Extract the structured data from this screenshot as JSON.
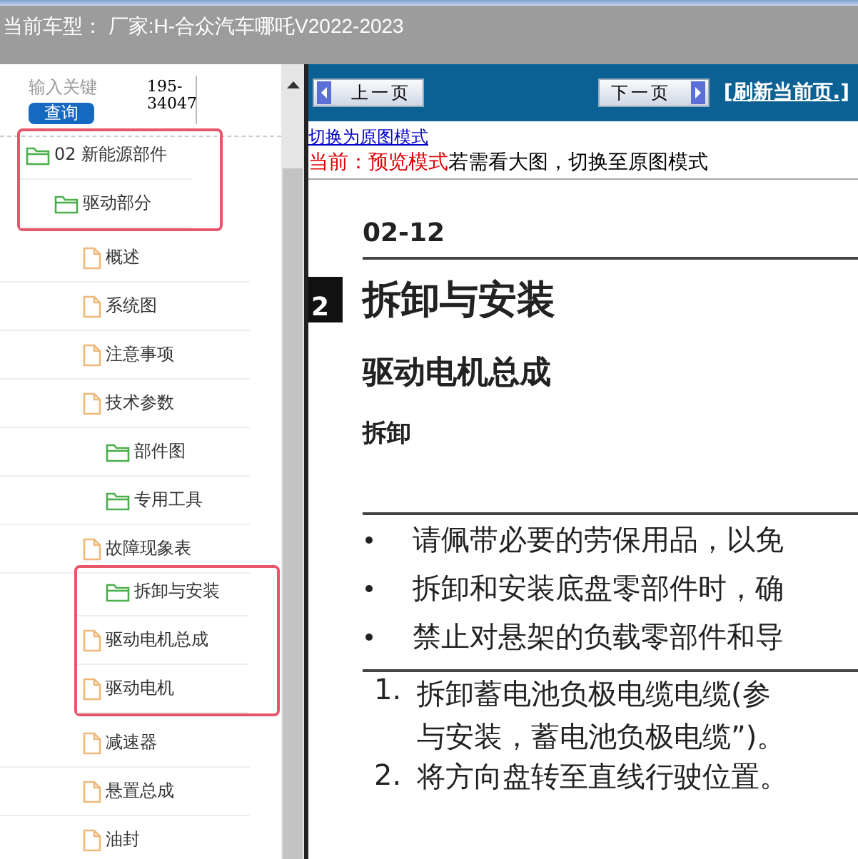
{
  "header": {
    "title": "当前车型：  厂家:H-合众汽车哪吒V2022-2023"
  },
  "search": {
    "placeholder": "输入关键",
    "button": "查询",
    "code": "195-34047"
  },
  "tree": [
    {
      "label": "02 新能源部件",
      "kind": "folder",
      "highlighted": true,
      "children": [
        {
          "label": "驱动部分",
          "kind": "folder",
          "highlighted": true,
          "children": [
            {
              "label": "概述",
              "kind": "file",
              "highlighted": false
            },
            {
              "label": "系统图",
              "kind": "file",
              "highlighted": false
            },
            {
              "label": "注意事项",
              "kind": "file",
              "highlighted": false
            },
            {
              "label": "技术参数",
              "kind": "file",
              "highlighted": false
            },
            {
              "label": "部件图",
              "kind": "folder",
              "highlighted": false
            },
            {
              "label": "专用工具",
              "kind": "folder",
              "highlighted": false
            },
            {
              "label": "故障现象表",
              "kind": "file",
              "highlighted": false
            },
            {
              "label": "拆卸与安装",
              "kind": "folder",
              "highlighted": true,
              "children": [
                {
                  "label": "驱动电机总成",
                  "kind": "file",
                  "highlighted": true
                },
                {
                  "label": "驱动电机",
                  "kind": "file",
                  "highlighted": true
                },
                {
                  "label": "减速器",
                  "kind": "file",
                  "highlighted": false
                },
                {
                  "label": "悬置总成",
                  "kind": "file",
                  "highlighted": false
                },
                {
                  "label": "油封",
                  "kind": "file",
                  "highlighted": false
                }
              ]
            }
          ]
        }
      ]
    }
  ],
  "toolbar": {
    "prev": "上一页",
    "next": "下一页",
    "refresh": "[刷新当前页.]"
  },
  "mode": {
    "link": "切换为原图模式",
    "status": "当前：预览模式",
    "hint": "若需看大图，切换至原图模式"
  },
  "document": {
    "page_number": "02-12",
    "tab": "2",
    "title": "拆卸与安装",
    "subtitle": "驱动电机总成",
    "section": "拆卸",
    "notes": [
      "请佩带必要的劳保用品，以免",
      "拆卸和安装底盘零部件时，确",
      "禁止对悬架的负载零部件和导"
    ],
    "steps": [
      {
        "number": "1.",
        "lines": [
          "拆卸蓄电池负极电缆电缆(参",
          "与安装，蓄电池负极电缆”)。"
        ]
      },
      {
        "number": "2.",
        "lines": [
          "将方向盘转至直线行驶位置。"
        ]
      }
    ]
  }
}
